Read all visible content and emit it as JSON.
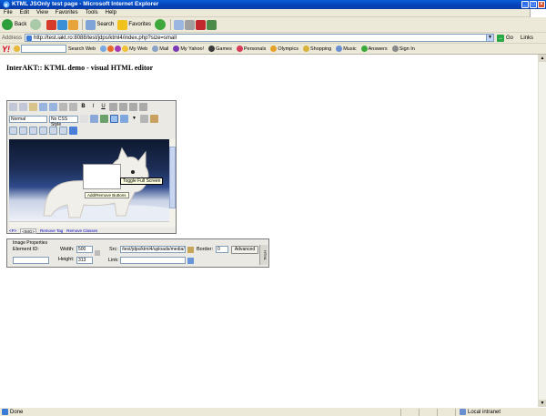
{
  "window": {
    "title": "KTML JSOnly test page - Microsoft Internet Explorer",
    "minimize": "_",
    "maximize": "□",
    "close": "×"
  },
  "menu": {
    "items": [
      "File",
      "Edit",
      "View",
      "Favorites",
      "Tools",
      "Help"
    ]
  },
  "toolbar": {
    "back_label": "Back",
    "search_label": "Search",
    "favorites_label": "Favorites"
  },
  "address": {
    "label": "Address",
    "url": "http://test.iakt.ro:8088/test/jdps/ktml4/index.php?size=small",
    "go_label": "Go",
    "links_label": "Links"
  },
  "yahoo": {
    "search_button": "Search Web",
    "items": [
      "My Web",
      "Mail",
      "My Yahoo!",
      "Games",
      "Personals",
      "Olympics",
      "Shopping",
      "Music",
      "Answers",
      "Sign In"
    ]
  },
  "page": {
    "heading": "InterAKT:: KTML demo - visual HTML editor"
  },
  "editor": {
    "format_select": "Normal",
    "css_select": "No CSS Style",
    "bold_label": "B",
    "italic_label": "I",
    "underline_label": "U",
    "tooltip_fullscreen": "Toggle Full Screen",
    "tooltip_addremove": "Add/Remove Buttons",
    "status_tags": [
      "<P>",
      "<IMG>"
    ],
    "remove_tag": "Remove Tag",
    "remove_classes": "Remove Classes"
  },
  "image_properties": {
    "legend": "Image Properties",
    "element_id_label": "Element ID:",
    "element_id_value": "",
    "width_label": "Width:",
    "width_value": "500",
    "height_label": "Height:",
    "height_value": "313",
    "src_label": "Src:",
    "src_value": "/test/jdps/ktml4/uploads/media/",
    "border_label": "Border:",
    "border_value": "0",
    "link_label": "Link:",
    "link_value": "",
    "advanced_button": "Advanced",
    "side_tab": "HTML"
  },
  "status": {
    "text": "Done",
    "zone": "Local intranet"
  }
}
